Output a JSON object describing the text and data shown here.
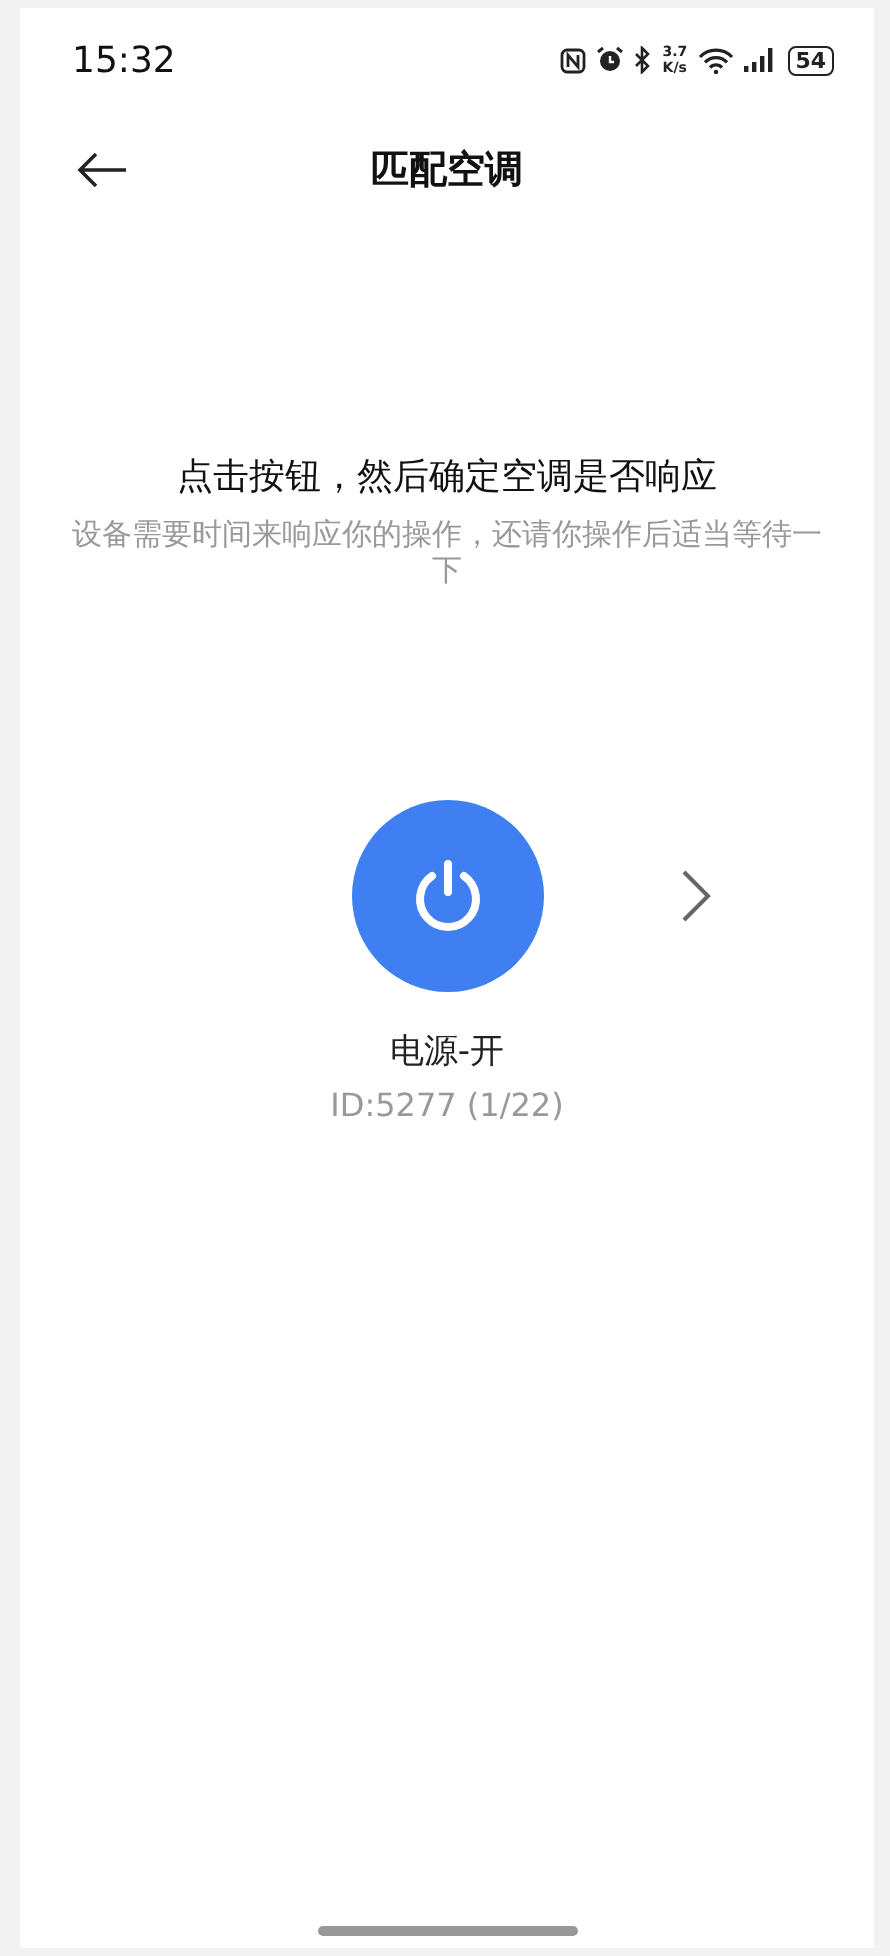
{
  "status_bar": {
    "time": "15:32",
    "net_speed_value": "3.7",
    "net_speed_unit": "K/s",
    "battery": "54"
  },
  "header": {
    "title": "匹配空调"
  },
  "instruction": {
    "title": "点击按钮，然后确定空调是否响应",
    "hint": "设备需要时间来响应你的操作，还请你操作后适当等待一下"
  },
  "test_key": {
    "label": "电源-开",
    "id": "ID:5277 (1/22)"
  }
}
